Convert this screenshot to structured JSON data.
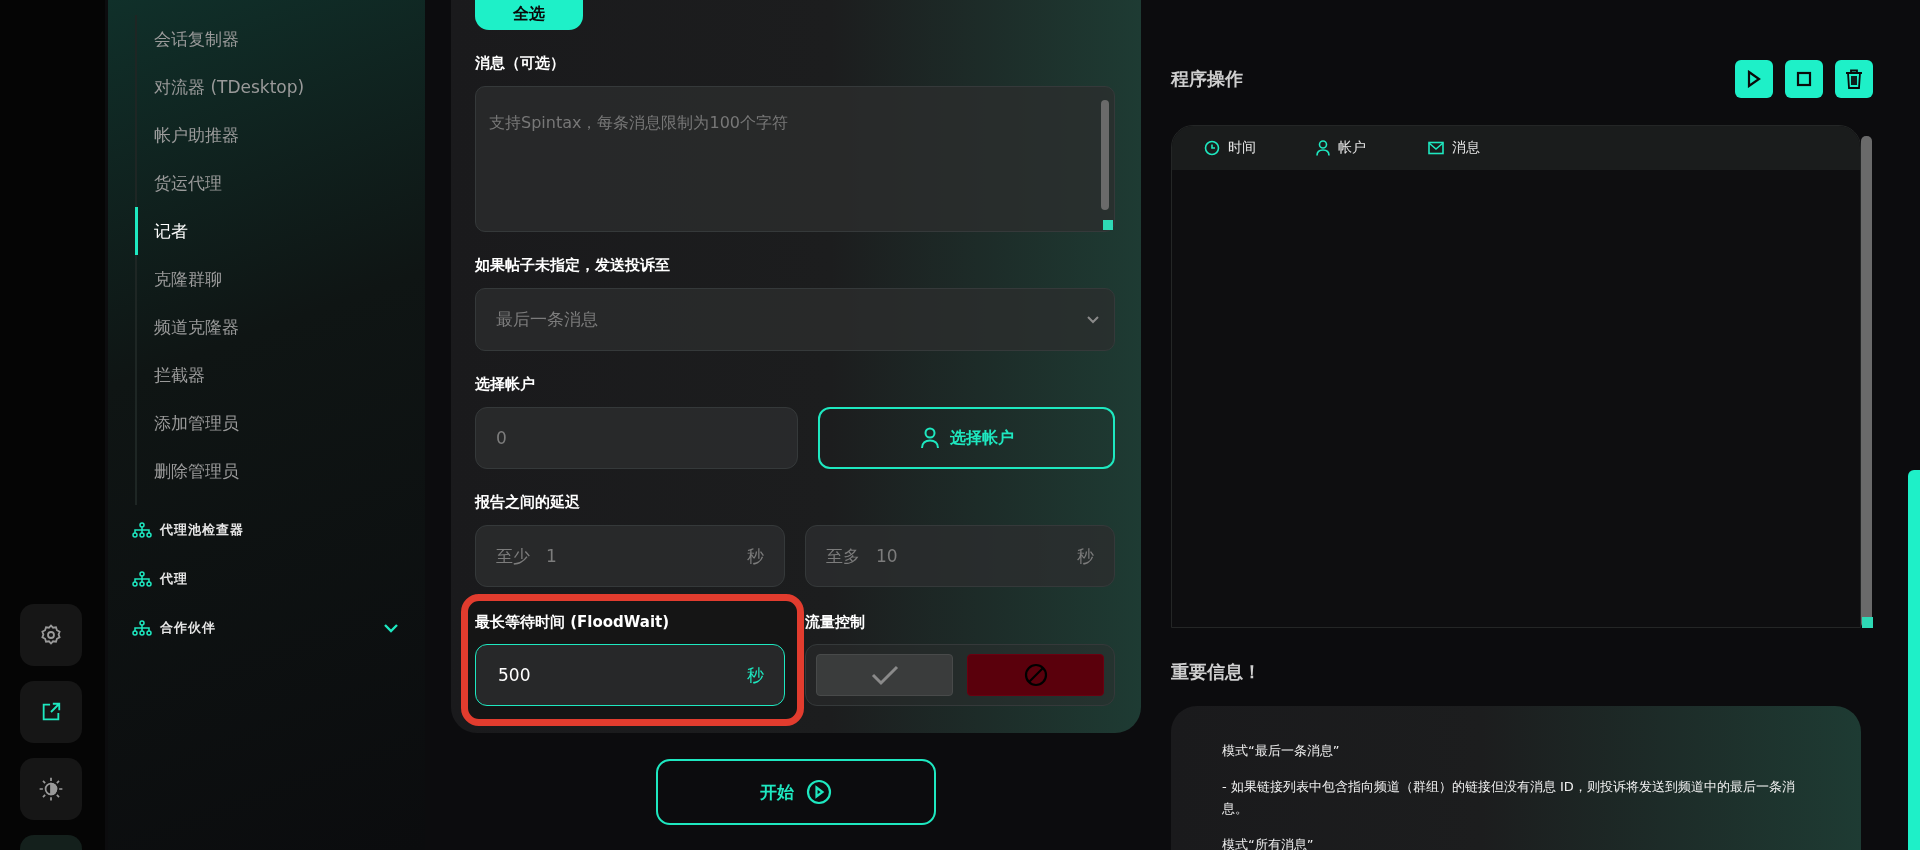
{
  "sidebar": {
    "items": [
      {
        "label": "会话复制器",
        "selected": false
      },
      {
        "label": "对流器 (TDesktop)",
        "selected": false
      },
      {
        "label": "帐户助推器",
        "selected": false
      },
      {
        "label": "货运代理",
        "selected": false
      },
      {
        "label": "记者",
        "selected": true
      },
      {
        "label": "克隆群聊",
        "selected": false
      },
      {
        "label": "频道克隆器",
        "selected": false
      },
      {
        "label": "拦截器",
        "selected": false
      },
      {
        "label": "添加管理员",
        "selected": false
      },
      {
        "label": "删除管理员",
        "selected": false
      }
    ],
    "groups": [
      {
        "label": "代理池检查器"
      },
      {
        "label": "代理"
      },
      {
        "label": "合作伙伴",
        "expanded": false
      }
    ]
  },
  "form": {
    "select_all": "全选",
    "message": {
      "label": "消息（可选）",
      "placeholder": "支持Spintax，每条消息限制为100个字符"
    },
    "target": {
      "label": "如果帖子未指定，发送投诉至",
      "value": "最后一条消息"
    },
    "accounts": {
      "label": "选择帐户",
      "placeholder": "0",
      "button": "选择帐户"
    },
    "delay": {
      "label": "报告之间的延迟",
      "min": {
        "prefix": "至少",
        "placeholder": "1",
        "unit": "秒"
      },
      "max": {
        "prefix": "至多",
        "placeholder": "10",
        "unit": "秒"
      }
    },
    "floodwait": {
      "label": "最长等待时间 (FloodWait)",
      "value": "500",
      "unit": "秒"
    },
    "flow_control": {
      "label": "流量控制",
      "options": [
        {
          "kind": "allow",
          "selected": false
        },
        {
          "kind": "block",
          "selected": true
        }
      ]
    },
    "start": "开始"
  },
  "log": {
    "title": "程序操作",
    "columns": [
      {
        "kind": "time",
        "label": "时间"
      },
      {
        "kind": "account",
        "label": "帐户"
      },
      {
        "kind": "message",
        "label": "消息"
      }
    ]
  },
  "info": {
    "title": "重要信息！",
    "paragraphs": [
      "模式“最后一条消息”",
      "- 如果链接列表中包含指向频道（群组）的链接但没有消息 ID，则投诉将发送到频道中的最后一条消息。",
      "模式“所有消息”"
    ]
  }
}
